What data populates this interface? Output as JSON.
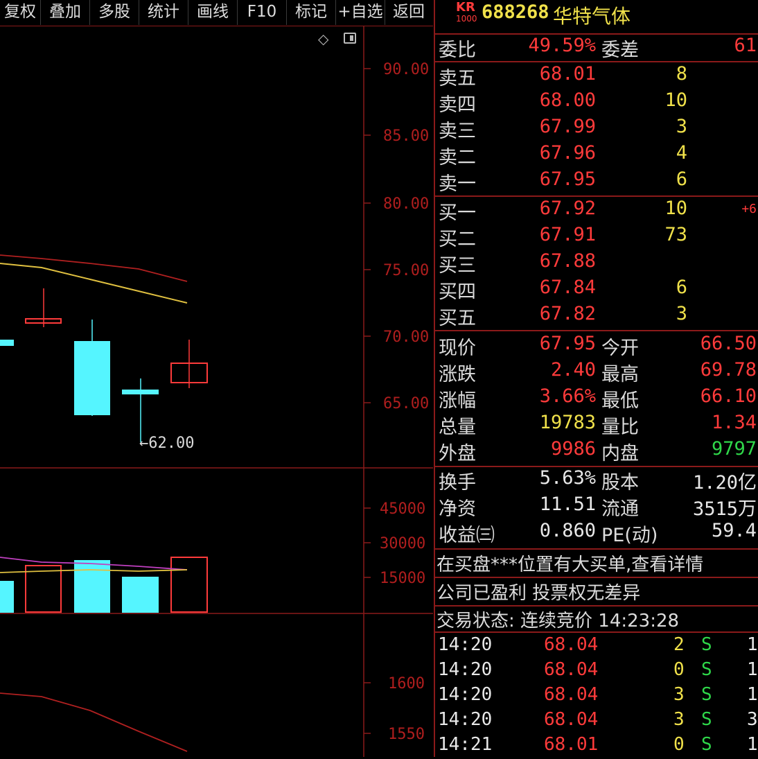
{
  "toolbar": {
    "buttons": [
      "复权",
      "叠加",
      "多股",
      "统计",
      "画线",
      "F10",
      "标记",
      "+自选",
      "返回"
    ]
  },
  "chart": {
    "price_axis": [
      "90.00",
      "85.00",
      "80.00",
      "75.00",
      "70.00",
      "65.00"
    ],
    "volume_axis": [
      "45000",
      "30000",
      "15000"
    ],
    "lower_axis": [
      "1600",
      "1550"
    ],
    "low_marker": "←62.00",
    "icons": [
      "diamond-icon",
      "panel-toggle-icon"
    ]
  },
  "header": {
    "badge_top": "KR",
    "badge_bottom": "1000",
    "code": "688268",
    "name": "华特气体"
  },
  "ratio": {
    "label": "委比",
    "value": "49.59%",
    "label2": "委差",
    "value2": "61"
  },
  "asks": [
    {
      "label": "卖五",
      "price": "68.01",
      "vol": "8"
    },
    {
      "label": "卖四",
      "price": "68.00",
      "vol": "10"
    },
    {
      "label": "卖三",
      "price": "67.99",
      "vol": "3"
    },
    {
      "label": "卖二",
      "price": "67.96",
      "vol": "4"
    },
    {
      "label": "卖一",
      "price": "67.95",
      "vol": "6"
    }
  ],
  "bids": [
    {
      "label": "买一",
      "price": "67.92",
      "vol": "10",
      "change": "+6"
    },
    {
      "label": "买二",
      "price": "67.91",
      "vol": "73",
      "change": ""
    },
    {
      "label": "买三",
      "price": "67.88",
      "vol": "",
      "change": ""
    },
    {
      "label": "买四",
      "price": "67.84",
      "vol": "6",
      "change": ""
    },
    {
      "label": "买五",
      "price": "67.82",
      "vol": "3",
      "change": ""
    }
  ],
  "quote": [
    {
      "l1": "现价",
      "v1": "67.95",
      "c1": "red",
      "l2": "今开",
      "v2": "66.50",
      "c2": "red"
    },
    {
      "l1": "涨跌",
      "v1": "2.40",
      "c1": "red",
      "l2": "最高",
      "v2": "69.78",
      "c2": "red"
    },
    {
      "l1": "涨幅",
      "v1": "3.66%",
      "c1": "red",
      "l2": "最低",
      "v2": "66.10",
      "c2": "red"
    },
    {
      "l1": "总量",
      "v1": "19783",
      "c1": "yellow",
      "l2": "量比",
      "v2": "1.34",
      "c2": "red"
    },
    {
      "l1": "外盘",
      "v1": "9986",
      "c1": "red",
      "l2": "内盘",
      "v2": "9797",
      "c2": "green"
    }
  ],
  "fundamentals": [
    {
      "l1": "换手",
      "v1": "5.63%",
      "l2": "股本",
      "v2": "1.20亿"
    },
    {
      "l1": "净资",
      "v1": "11.51",
      "l2": "流通",
      "v2": "3515万"
    },
    {
      "l1": "收益㈢",
      "v1": "0.860",
      "l2": "PE(动)",
      "v2": "59.4"
    }
  ],
  "notices": [
    "在买盘***位置有大买单,查看详情",
    "公司已盈利 投票权无差异",
    "交易状态: 连续竞价 14:23:28"
  ],
  "ticks": [
    {
      "time": "14:20",
      "price": "68.04",
      "vol": "2",
      "side": "S",
      "num": "1"
    },
    {
      "time": "14:20",
      "price": "68.04",
      "vol": "0",
      "side": "S",
      "num": "1"
    },
    {
      "time": "14:20",
      "price": "68.04",
      "vol": "3",
      "side": "S",
      "num": "1"
    },
    {
      "time": "14:20",
      "price": "68.04",
      "vol": "3",
      "side": "S",
      "num": "3"
    },
    {
      "time": "14:21",
      "price": "68.01",
      "vol": "0",
      "side": "S",
      "num": "1"
    }
  ],
  "colors": {
    "up": "#ff3b3b",
    "down": "#55f5ff",
    "ma5": "#e0c040",
    "ma10": "#b02020",
    "vol_ma": "#c040c0",
    "grid": "#8b1a1a"
  }
}
